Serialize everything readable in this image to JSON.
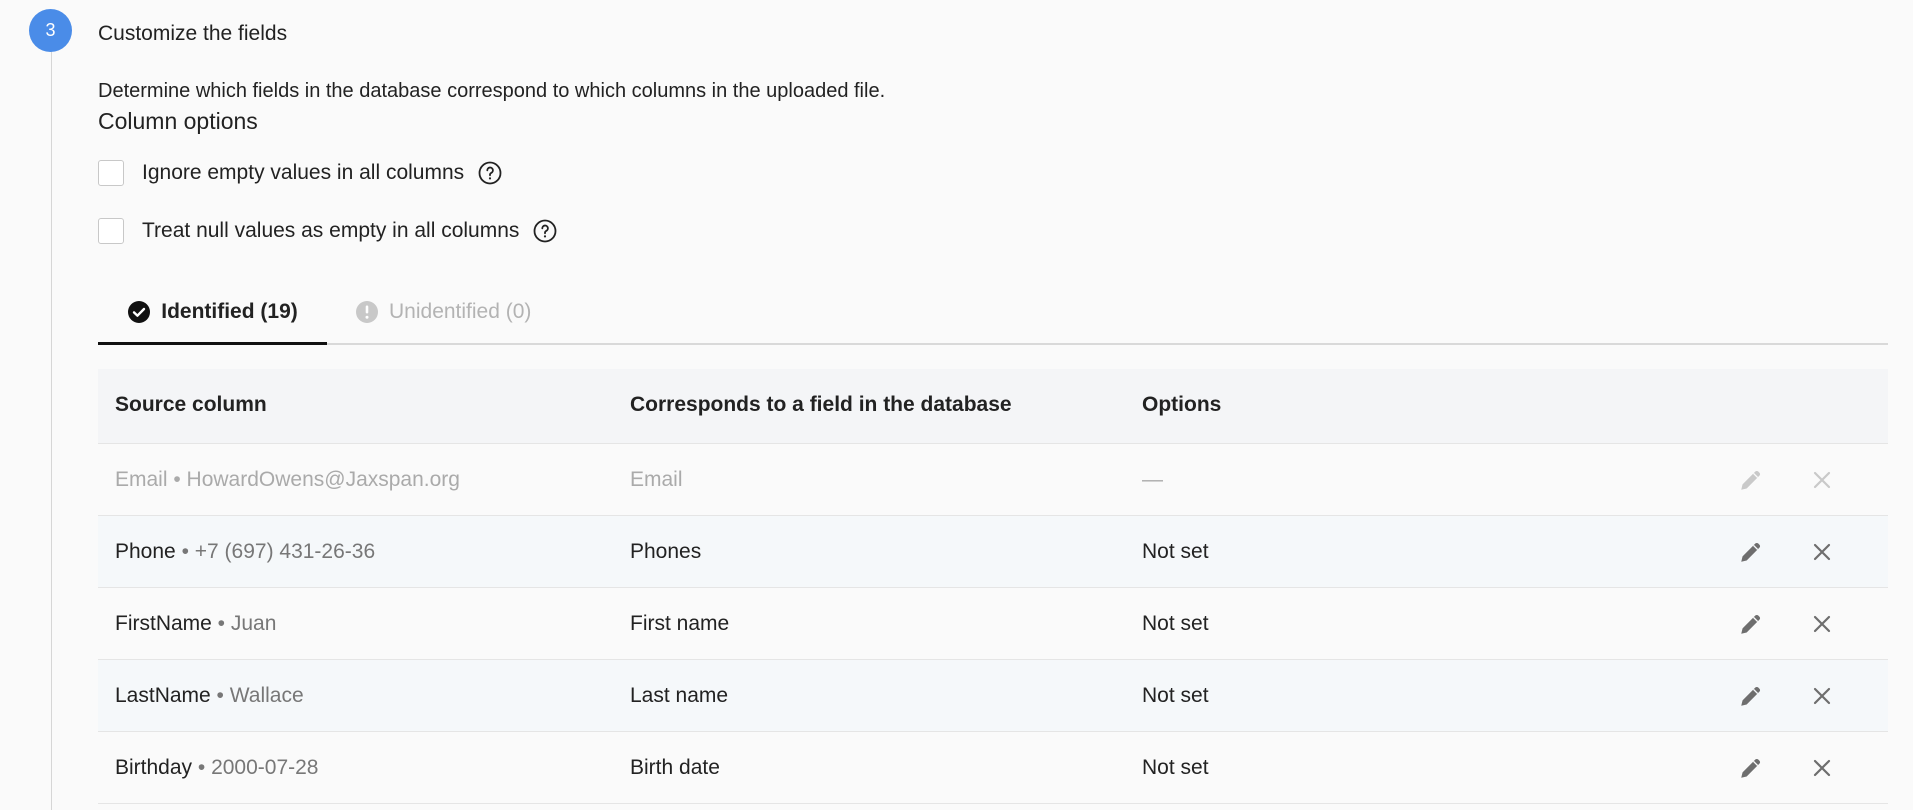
{
  "step": {
    "number": "3",
    "title": "Customize the fields",
    "description": "Determine which fields in the database correspond to which columns in the uploaded file."
  },
  "column_options": {
    "title": "Column options",
    "ignore_empty_label": "Ignore empty values in all columns",
    "treat_null_label": "Treat null values as empty in all columns"
  },
  "tabs": [
    {
      "label": "Identified (19)",
      "icon": "check-circle-icon",
      "active": true
    },
    {
      "label": "Unidentified (0)",
      "icon": "exclamation-circle-icon",
      "active": false
    }
  ],
  "table": {
    "headers": {
      "source": "Source column",
      "field": "Corresponds to a field in the database",
      "options": "Options"
    },
    "rows": [
      {
        "source": "Email",
        "sample": " • HowardOwens@Jaxspan.org",
        "field": "Email",
        "options": "—"
      },
      {
        "source": "Phone",
        "sample": " • +7 (697) 431-26-36",
        "field": "Phones",
        "options": "Not set"
      },
      {
        "source": "FirstName",
        "sample": " • Juan",
        "field": "First name",
        "options": "Not set"
      },
      {
        "source": "LastName",
        "sample": " • Wallace",
        "field": "Last name",
        "options": "Not set"
      },
      {
        "source": "Birthday",
        "sample": " • 2000-07-28",
        "field": "Birth date",
        "options": "Not set"
      }
    ]
  },
  "colors": {
    "accent": "#4a8ce8",
    "muted": "#aaaaaa"
  }
}
